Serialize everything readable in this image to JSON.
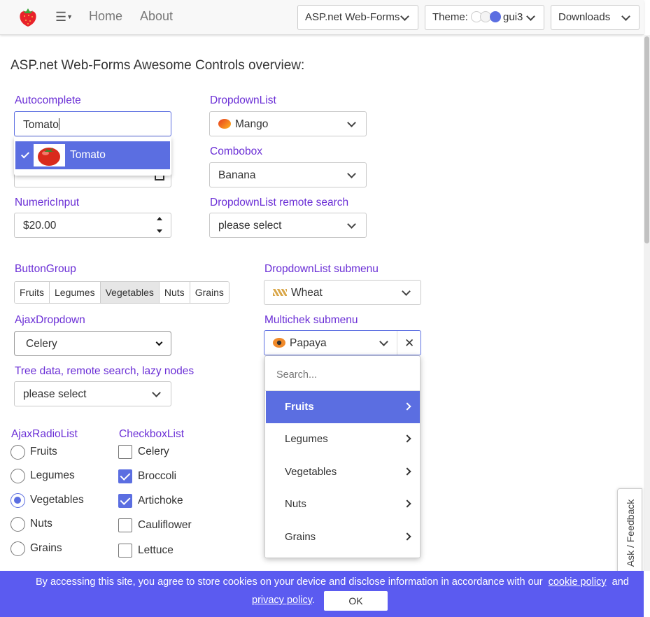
{
  "nav": {
    "home": "Home",
    "about": "About",
    "framework_select": "ASP.net Web-Forms",
    "theme_label": "Theme:",
    "theme_value": "gui3",
    "downloads": "Downloads"
  },
  "page_title": "ASP.net Web-Forms Awesome Controls overview:",
  "autocomplete": {
    "label": "Autocomplete",
    "value": "Tomato",
    "suggestion": "Tomato"
  },
  "dropdownlist": {
    "label": "DropdownList",
    "value": "Mango"
  },
  "combobox": {
    "label": "Combobox",
    "value": "Banana"
  },
  "numeric_input": {
    "label": "NumericInput",
    "value": "$20.00"
  },
  "dropdown_remote": {
    "label": "DropdownList remote search",
    "value": "please select"
  },
  "button_group": {
    "label": "ButtonGroup",
    "buttons": [
      "Fruits",
      "Legumes",
      "Vegetables",
      "Nuts",
      "Grains"
    ],
    "selected": "Vegetables"
  },
  "dropdown_submenu": {
    "label": "DropdownList submenu",
    "value": "Wheat"
  },
  "ajax_dropdown": {
    "label": "AjaxDropdown",
    "value": "Celery"
  },
  "multichek_submenu": {
    "label": "Multichek submenu",
    "value": "Papaya",
    "search_placeholder": "Search...",
    "items": [
      "Fruits",
      "Legumes",
      "Vegetables",
      "Nuts",
      "Grains"
    ]
  },
  "tree_data": {
    "label": "Tree data, remote search, lazy nodes",
    "value": "please select"
  },
  "ajax_radio_list": {
    "label": "AjaxRadioList",
    "options": [
      "Fruits",
      "Legumes",
      "Vegetables",
      "Nuts",
      "Grains"
    ],
    "selected": "Vegetables"
  },
  "checkbox_list": {
    "label": "CheckboxList",
    "options": [
      "Celery",
      "Broccoli",
      "Artichoke",
      "Cauliflower",
      "Lettuce"
    ],
    "checked": [
      "Broccoli",
      "Artichoke"
    ]
  },
  "feedback": "Ask / Feedback",
  "cookie": {
    "text": "By accessing this site, you agree to store cookies on your device and disclose information in accordance with our",
    "cookie_policy": "cookie policy",
    "and": "and",
    "privacy_policy": "privacy policy",
    "period": ".",
    "ok": "OK"
  },
  "colors": {
    "accent": "#5b6ee1",
    "label": "#6b2fd6",
    "cookie_bar": "#5b5bf0"
  }
}
